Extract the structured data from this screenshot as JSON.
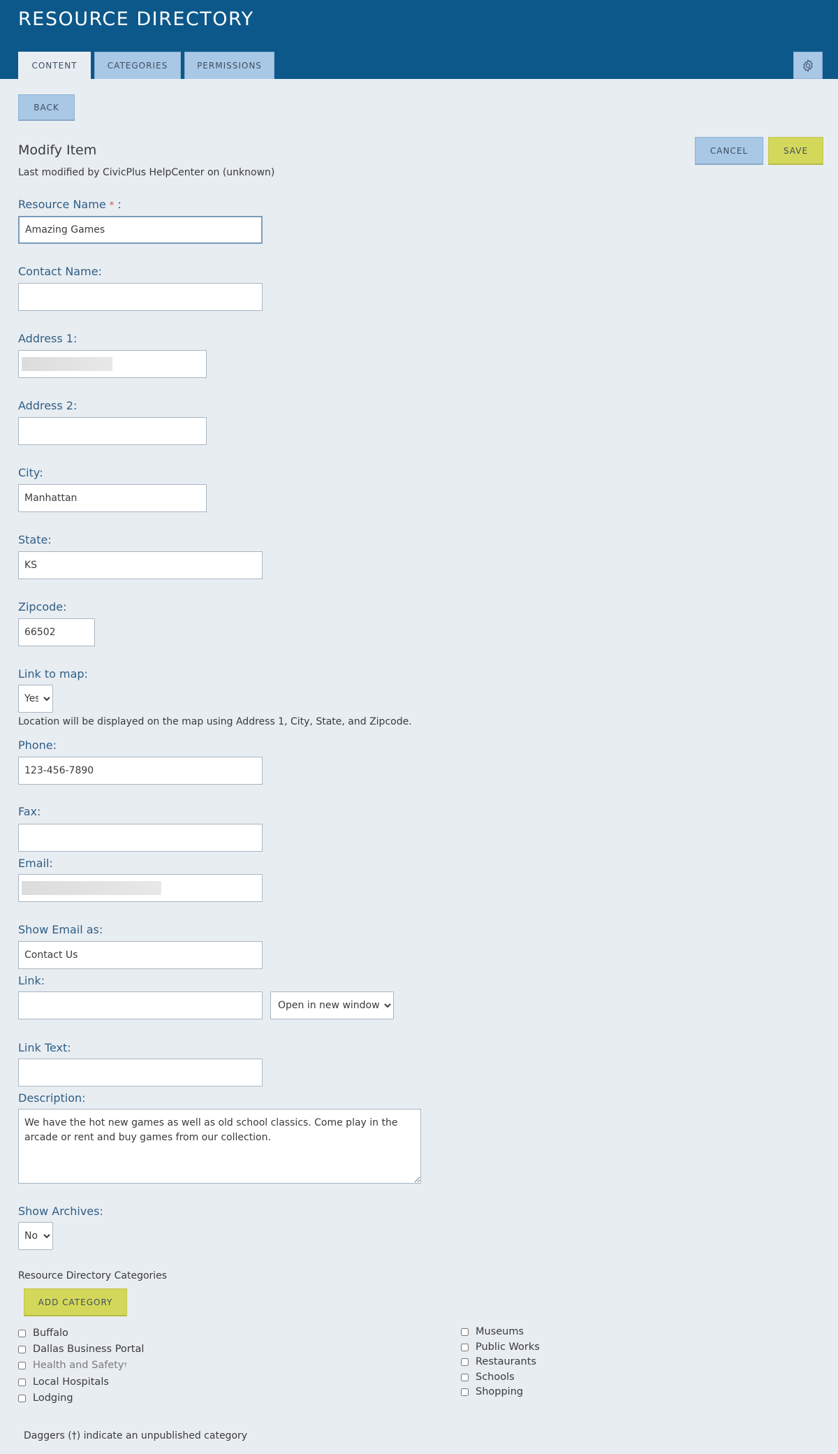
{
  "app": {
    "title": "RESOURCE DIRECTORY"
  },
  "tabs": [
    {
      "label": "CONTENT",
      "active": true
    },
    {
      "label": "CATEGORIES",
      "active": false
    },
    {
      "label": "PERMISSIONS",
      "active": false
    }
  ],
  "icons": {
    "settings": "gear-icon",
    "dropdown": "chevron-down-icon"
  },
  "colors": {
    "header": "#0d588a",
    "tab_inactive": "#a9c8e6",
    "save_button": "#d4d85a",
    "label": "#2f5e84",
    "page_background": "#e8edf2"
  },
  "toolbar": {
    "back_label": "BACK",
    "cancel_label": "CANCEL",
    "save_label": "SAVE"
  },
  "page": {
    "heading": "Modify Item",
    "meta": "Last modified by CivicPlus HelpCenter on (unknown)"
  },
  "form": {
    "resource_name": {
      "label": "Resource Name",
      "required_marker": "*",
      "suffix": " :",
      "value": "Amazing Games"
    },
    "contact_name": {
      "label": "Contact Name:",
      "value": ""
    },
    "address1": {
      "label": "Address 1:",
      "value": ""
    },
    "address2": {
      "label": "Address 2:",
      "value": ""
    },
    "city": {
      "label": "City:",
      "value": "Manhattan"
    },
    "state": {
      "label": "State:",
      "value": "KS"
    },
    "zipcode": {
      "label": "Zipcode:",
      "value": "66502"
    },
    "link_to_map": {
      "label": "Link to map:",
      "value": "Yes",
      "helper": "Location will be displayed on the map using Address 1, City, State, and Zipcode."
    },
    "phone": {
      "label": "Phone:",
      "value": "123-456-7890"
    },
    "fax": {
      "label": "Fax:",
      "value": ""
    },
    "email": {
      "label": "Email:",
      "value": ""
    },
    "show_email_as": {
      "label": "Show Email as:",
      "value": "Contact Us"
    },
    "link": {
      "label": "Link:",
      "value": "",
      "target": "Open in new window"
    },
    "link_text": {
      "label": "Link Text:",
      "value": ""
    },
    "description": {
      "label": "Description:",
      "value": "We have the hot new games as well as old school classics. Come play in the arcade or rent and buy games from our collection."
    },
    "show_archives": {
      "label": "Show Archives:",
      "value": "No"
    }
  },
  "categories": {
    "title": "Resource Directory Categories",
    "add_label": "ADD CATEGORY",
    "left": [
      {
        "label": "Buffalo",
        "unpublished": false
      },
      {
        "label": "Dallas Business Portal",
        "unpublished": false
      },
      {
        "label": "Health and Safety",
        "unpublished": true,
        "marker": "†"
      },
      {
        "label": "Local Hospitals",
        "unpublished": false
      },
      {
        "label": "Lodging",
        "unpublished": false
      }
    ],
    "right": [
      {
        "label": "Museums",
        "unpublished": false
      },
      {
        "label": "Public Works",
        "unpublished": false
      },
      {
        "label": "Restaurants",
        "unpublished": false
      },
      {
        "label": "Schools",
        "unpublished": false
      },
      {
        "label": "Shopping",
        "unpublished": false
      }
    ],
    "footnote": "Daggers (†) indicate an unpublished category"
  }
}
